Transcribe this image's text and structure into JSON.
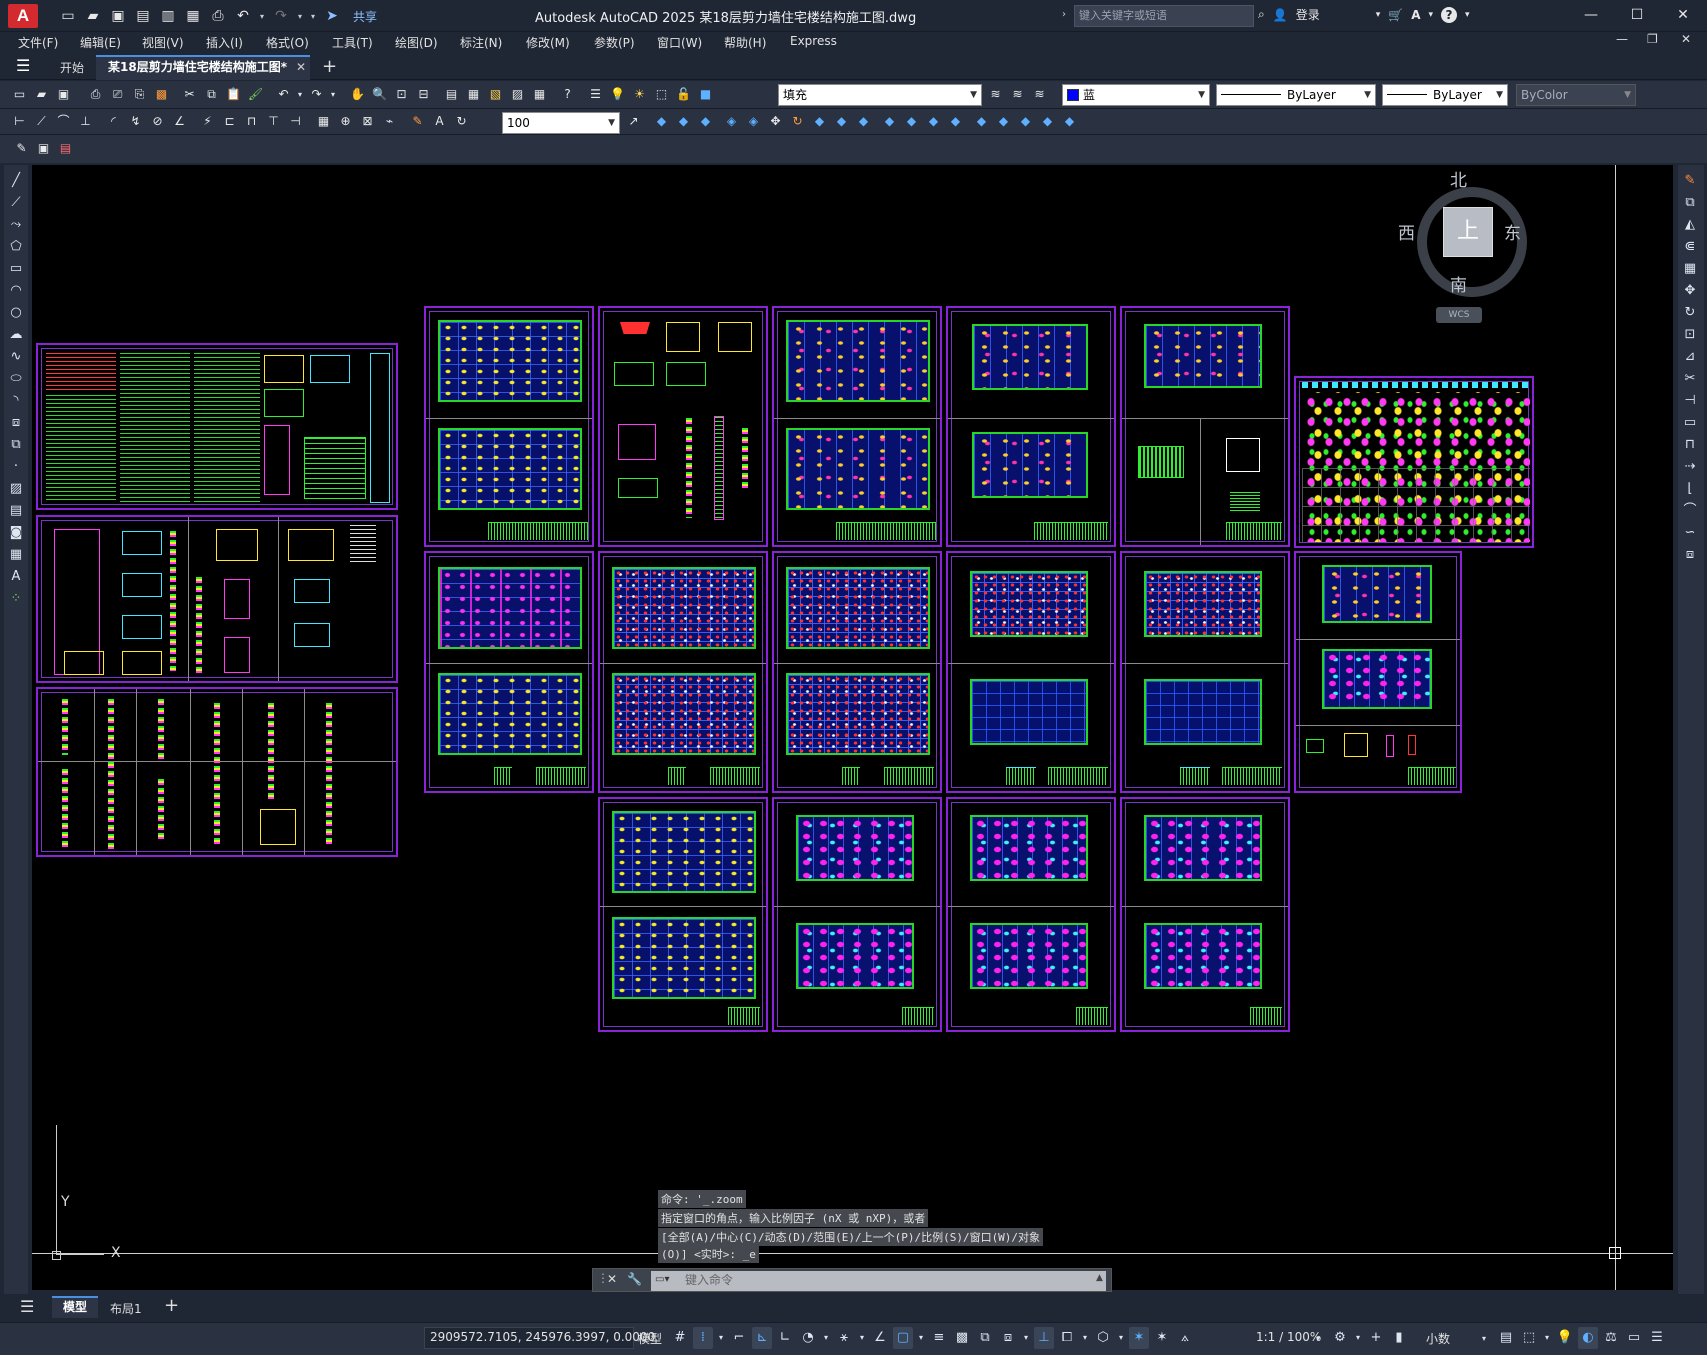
{
  "app": {
    "logo": "A",
    "title": "Autodesk AutoCAD 2025    某18层剪力墙住宅楼结构施工图.dwg",
    "share": "共享"
  },
  "search": {
    "placeholder": "键入关键字或短语"
  },
  "user": {
    "login": "登录"
  },
  "window_controls": {
    "minimize": "—",
    "maximize": "☐",
    "close": "✕",
    "doc_min": "—",
    "doc_restore": "❐",
    "doc_close": "✕"
  },
  "menu": [
    "文件(F)",
    "编辑(E)",
    "视图(V)",
    "插入(I)",
    "格式(O)",
    "工具(T)",
    "绘图(D)",
    "标注(N)",
    "修改(M)",
    "参数(P)",
    "窗口(W)",
    "帮助(H)",
    "Express"
  ],
  "tabs": {
    "start": "开始",
    "doc": "某18层剪力墙住宅楼结构施工图*",
    "close": "✕",
    "add": "+"
  },
  "properties": {
    "layer": "填充",
    "color": "蓝",
    "color_hex": "#0000ff",
    "linetype": "ByLayer",
    "lineweight": "ByLayer",
    "plotstyle": "ByColor",
    "dimscale": "100"
  },
  "viewcube": {
    "north": "北",
    "south": "南",
    "east": "东",
    "west": "西",
    "face": "上",
    "wcs": "WCS"
  },
  "ucs": {
    "y": "Y",
    "x": "X"
  },
  "command": {
    "history": [
      "命令: '_.zoom",
      "指定窗口的角点，输入比例因子 (nX 或 nXP)，或者",
      "[全部(A)/中心(C)/动态(D)/范围(E)/上一个(P)/比例(S)/窗口(W)/对象",
      "(O)] <实时>: _e"
    ],
    "placeholder": "键入命令"
  },
  "layout_tabs": {
    "model": "模型",
    "layout1": "布局1",
    "add": "+"
  },
  "status": {
    "coords": "2909572.7105, 245976.3997, 0.0000",
    "space": "模型",
    "annoscale": "1:1 / 100%",
    "units": "小数"
  },
  "colors": {
    "sheet_border": "#8a22d9",
    "plan_fill": "#0a1a9e",
    "accent": "#4a8fe0",
    "logo": "#d22a2f"
  }
}
